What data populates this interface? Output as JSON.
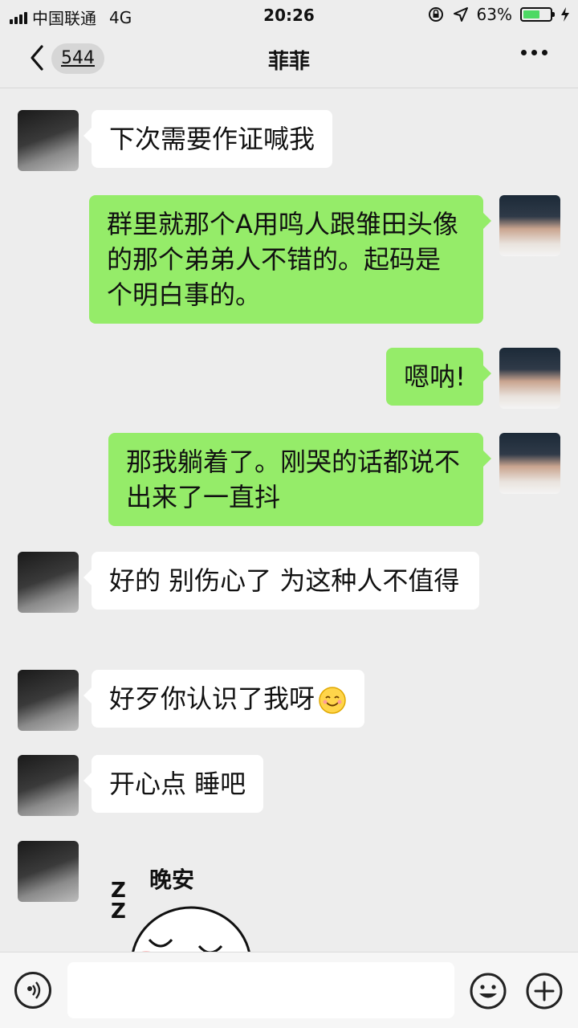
{
  "status_bar": {
    "carrier": "中国联通",
    "network": "4G",
    "time": "20:26",
    "battery_percent": "63%",
    "battery_level": 0.63
  },
  "nav": {
    "unread_count": "544",
    "title": "菲菲"
  },
  "messages": [
    {
      "sender": "friend",
      "text": "下次需要作证喊我"
    },
    {
      "sender": "me",
      "text": "群里就那个A用鸣人跟雏田头像的那个弟弟人不错的。起码是个明白事的。"
    },
    {
      "sender": "me",
      "text": "嗯呐!"
    },
    {
      "sender": "me",
      "text": "那我躺着了。刚哭的话都说不出来了一直抖"
    },
    {
      "sender": "friend",
      "text": "好的 别伤心了 为这种人不值得"
    },
    {
      "sender": "friend",
      "text": "好歹你认识了我呀"
    },
    {
      "sender": "friend",
      "text": "开心点 睡吧"
    }
  ],
  "sticker": {
    "text": "晚安",
    "zz": "Z Z"
  },
  "input": {
    "placeholder": ""
  },
  "colors": {
    "my_bubble": "#95ec69",
    "friend_bubble": "#ffffff",
    "background": "#ededed",
    "battery_fill": "#4cd964"
  }
}
